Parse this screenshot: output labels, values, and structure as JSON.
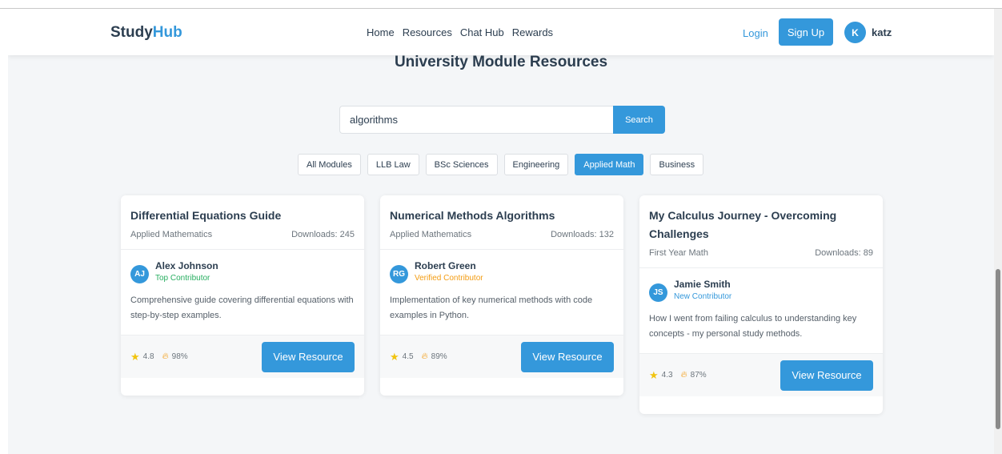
{
  "header": {
    "logo_study": "Study",
    "logo_hub": "Hub",
    "nav": [
      "Home",
      "Resources",
      "Chat Hub",
      "Rewards"
    ],
    "login": "Login",
    "signup": "Sign Up",
    "user_initial": "K",
    "username": "katz"
  },
  "page": {
    "title": "University Module Resources"
  },
  "search": {
    "value": "algorithms",
    "button": "Search"
  },
  "filters": [
    "All Modules",
    "LLB Law",
    "BSc Sciences",
    "Engineering",
    "Applied Math",
    "Business"
  ],
  "active_filter": "Applied Math",
  "cards": [
    {
      "title": "Differential Equations Guide",
      "category": "Applied Mathematics",
      "downloads": "Downloads: 245",
      "author_initials": "AJ",
      "author_name": "Alex Johnson",
      "author_role": "Top Contributor",
      "description": "Comprehensive guide covering differential equations with step-by-step examples.",
      "rating": "4.8",
      "percent": "98%",
      "button": "View Resource"
    },
    {
      "title": "Numerical Methods Algorithms",
      "category": "Applied Mathematics",
      "downloads": "Downloads: 132",
      "author_initials": "RG",
      "author_name": "Robert Green",
      "author_role": "Verified Contributor",
      "description": "Implementation of key numerical methods with code examples in Python.",
      "rating": "4.5",
      "percent": "89%",
      "button": "View Resource"
    },
    {
      "title": "My Calculus Journey - Overcoming Challenges",
      "category": "First Year Math",
      "downloads": "Downloads: 89",
      "author_initials": "JS",
      "author_name": "Jamie Smith",
      "author_role": "New Contributor",
      "description": "How I went from failing calculus to understanding key concepts - my personal study methods.",
      "rating": "4.3",
      "percent": "87%",
      "button": "View Resource"
    }
  ],
  "colors": {
    "accent": "#3498db",
    "text": "#2c3e50",
    "role_top": "#27ae60",
    "role_verified": "#f39c12",
    "role_new": "#3498db"
  },
  "icons": {
    "rating": "star-icon",
    "success": "fire-icon"
  }
}
